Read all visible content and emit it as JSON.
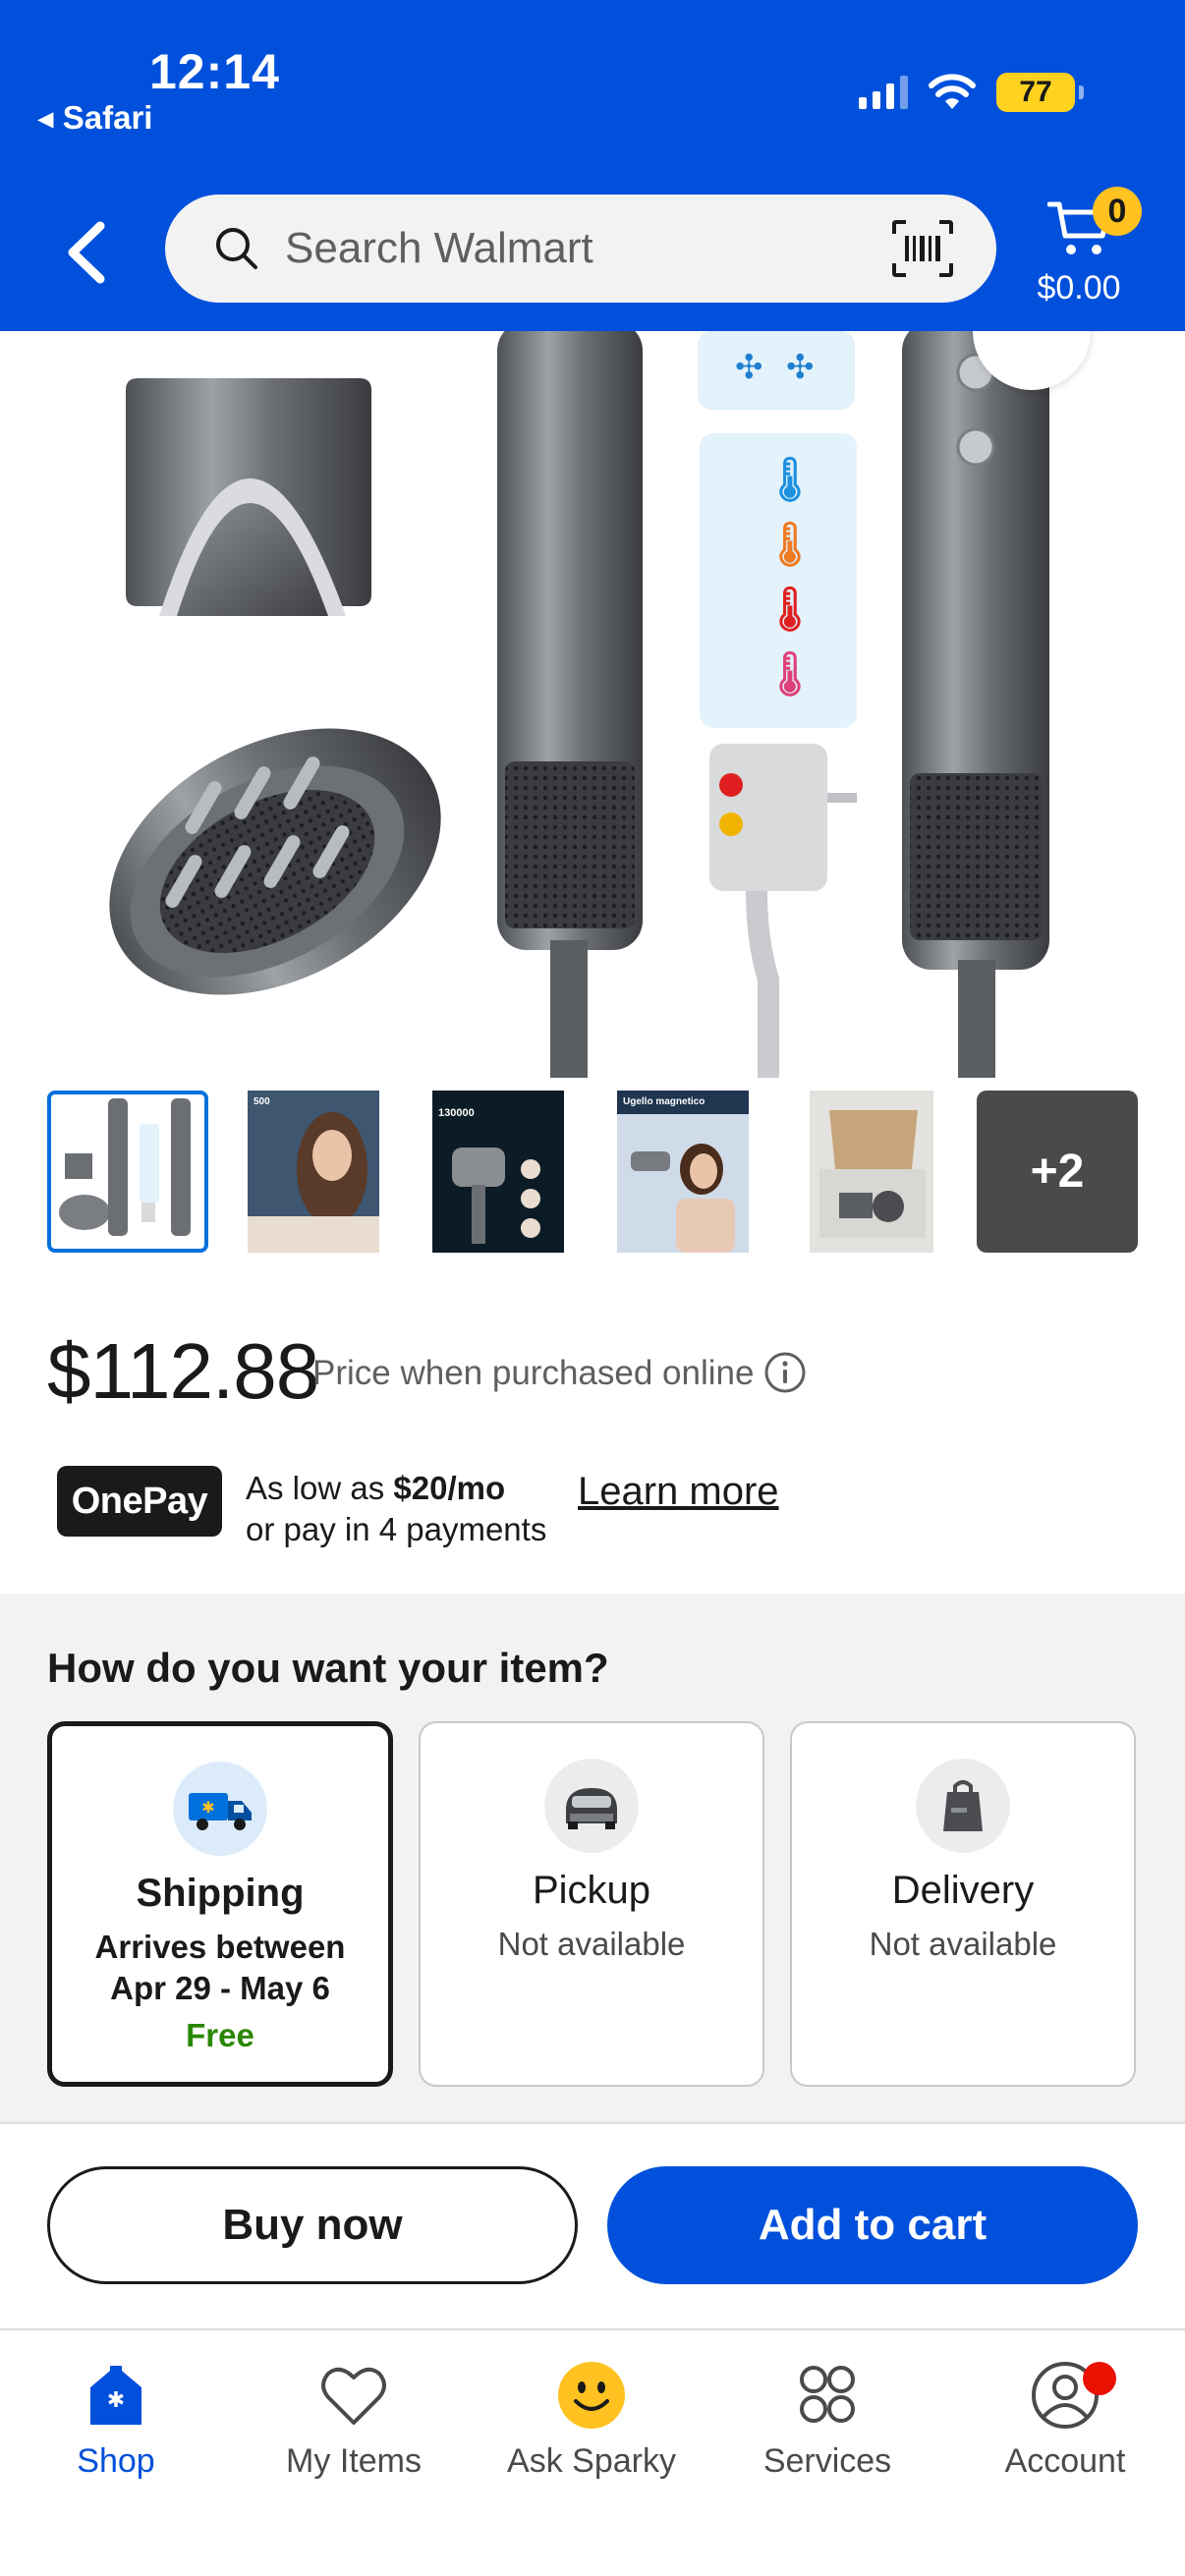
{
  "status_bar": {
    "time": "12:14",
    "back_app": "◂ Safari",
    "battery": "77"
  },
  "header": {
    "search_placeholder": "Search Walmart",
    "cart_count": "0",
    "cart_total": "$0.00",
    "brand_color": "#0050dc"
  },
  "product": {
    "thumbnails": [
      {
        "name": "thumbnail-1",
        "selected": true
      },
      {
        "name": "thumbnail-2",
        "text": "500"
      },
      {
        "name": "thumbnail-3",
        "text": "130000"
      },
      {
        "name": "thumbnail-4",
        "text": "Ugello magnetico"
      },
      {
        "name": "thumbnail-5"
      }
    ],
    "more_thumbnails": "+2",
    "price": "$112.88",
    "price_note": "Price when purchased online",
    "onepay": {
      "logo": "OnePay",
      "as_low_as_prefix": "As low as ",
      "as_low_as_amount": "$20/mo",
      "line2": "or pay in 4 payments",
      "learn_more": "Learn more"
    }
  },
  "fulfillment": {
    "title": "How do you want your item?",
    "options": [
      {
        "title": "Shipping",
        "line1": "Arrives between",
        "line2": "Apr 29 - May 6",
        "extra": "Free",
        "selected": true,
        "icon": "truck-icon"
      },
      {
        "title": "Pickup",
        "line1": "Not available",
        "selected": false,
        "icon": "car-icon"
      },
      {
        "title": "Delivery",
        "line1": "Not available",
        "selected": false,
        "icon": "bag-icon"
      }
    ]
  },
  "actions": {
    "buy_now": "Buy now",
    "add_to_cart": "Add to cart"
  },
  "bottom_nav": [
    {
      "label": "Shop",
      "active": true,
      "icon": "shop-icon"
    },
    {
      "label": "My Items",
      "active": false,
      "icon": "heart-icon"
    },
    {
      "label": "Ask Sparky",
      "active": false,
      "icon": "sparky-icon"
    },
    {
      "label": "Services",
      "active": false,
      "icon": "services-grid-icon"
    },
    {
      "label": "Account",
      "active": false,
      "icon": "account-icon"
    }
  ]
}
